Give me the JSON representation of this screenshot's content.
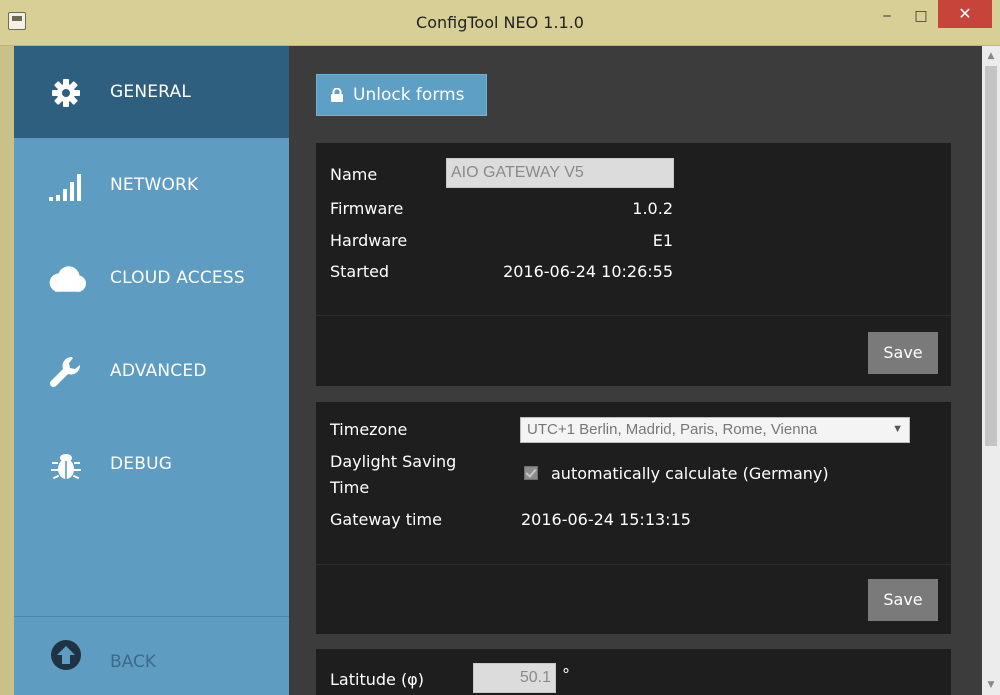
{
  "window": {
    "title": "ConfigTool NEO 1.1.0",
    "minimize": "‒",
    "maximize": "□",
    "close": "✕"
  },
  "sidebar": {
    "items": [
      {
        "label": "GENERAL",
        "icon": "gear-icon",
        "active": true
      },
      {
        "label": "NETWORK",
        "icon": "signal-bars-icon",
        "active": false
      },
      {
        "label": "CLOUD ACCESS",
        "icon": "cloud-icon",
        "active": false
      },
      {
        "label": "ADVANCED",
        "icon": "wrench-icon",
        "active": false
      },
      {
        "label": "DEBUG",
        "icon": "bug-icon",
        "active": false
      }
    ],
    "back": {
      "label": "BACK",
      "icon": "arrow-up-circle-icon"
    }
  },
  "main": {
    "unlock_label": "Unlock forms",
    "device": {
      "name_label": "Name",
      "name_value": "AIO GATEWAY V5",
      "firmware_label": "Firmware",
      "firmware_value": "1.0.2",
      "hardware_label": "Hardware",
      "hardware_value": "E1",
      "started_label": "Started",
      "started_value": "2016-06-24 10:26:55",
      "save_label": "Save"
    },
    "time": {
      "timezone_label": "Timezone",
      "timezone_value": "UTC+1  Berlin, Madrid, Paris, Rome, Vienna",
      "dst_label_line1": "Daylight Saving",
      "dst_label_line2": "Time",
      "dst_checkbox_label": "automatically calculate (Germany)",
      "dst_checked": true,
      "gateway_time_label": "Gateway time",
      "gateway_time_value": "2016-06-24 15:13:15",
      "save_label": "Save"
    },
    "location": {
      "latitude_label": "Latitude (φ)",
      "latitude_value": "50.1",
      "latitude_unit": "°"
    }
  },
  "colors": {
    "sidebar": "#5e9cc1",
    "sidebar_active": "#2f5f7f",
    "main_bg": "#3c3c3c",
    "card_bg": "#1e1e1e",
    "accent_button": "#5d9fc5",
    "save_button": "#7a7a7a",
    "titlebar": "#d8cf97",
    "close_button": "#c7443a"
  }
}
